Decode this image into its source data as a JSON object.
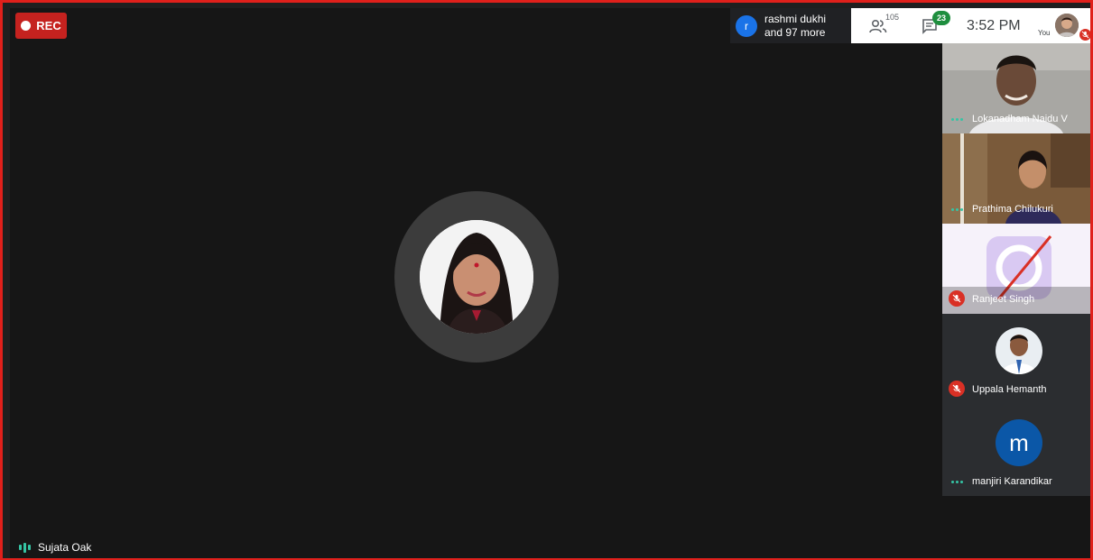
{
  "recording": {
    "label": "REC"
  },
  "top_bar": {
    "join_notice": {
      "avatar_letter": "r",
      "line1": "rashmi dukhi",
      "line2": "and 97 more"
    },
    "participants_count": "105",
    "chat_badge": "23",
    "clock": "3:52 PM",
    "self_label": "You"
  },
  "main_speaker": {
    "name": "Sujata Oak"
  },
  "participants": [
    {
      "name": "Lokanadham Naidu V",
      "status": "speaking"
    },
    {
      "name": "Prathima Chilukuri",
      "status": "speaking"
    },
    {
      "name": "Ranjeet Singh",
      "status": "muted"
    },
    {
      "name": "Uppala Hemanth",
      "status": "muted"
    },
    {
      "name": "manjiri Karandikar",
      "status": "speaking",
      "avatar_letter": "m"
    }
  ],
  "colors": {
    "accent_red": "#c5221f",
    "speaking": "#35c4a4",
    "badge_green": "#1e8e3e",
    "avatar_blue": "#0b57a7"
  }
}
